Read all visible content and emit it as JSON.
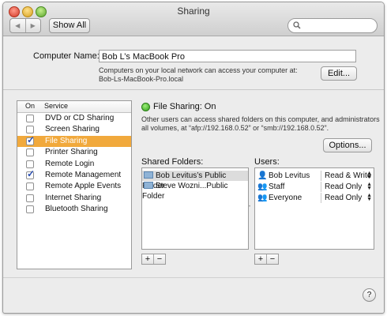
{
  "window": {
    "title": "Sharing"
  },
  "toolbar": {
    "back": "◀",
    "forward": "▶",
    "show_all": "Show All",
    "search_placeholder": ""
  },
  "computer_name": {
    "label": "Computer Name:",
    "value": "Bob L’s MacBook Pro",
    "info_line1": "Computers on your local network can access your computer at:",
    "info_line2": "Bob-Ls-MacBook-Pro.local",
    "edit_button": "Edit..."
  },
  "services": {
    "col_on": "On",
    "col_service": "Service",
    "items": [
      {
        "name": "DVD or CD Sharing",
        "on": false,
        "selected": false
      },
      {
        "name": "Screen Sharing",
        "on": false,
        "selected": false
      },
      {
        "name": "File Sharing",
        "on": true,
        "selected": true
      },
      {
        "name": "Printer Sharing",
        "on": false,
        "selected": false
      },
      {
        "name": "Remote Login",
        "on": false,
        "selected": false
      },
      {
        "name": "Remote Management",
        "on": true,
        "selected": false
      },
      {
        "name": "Remote Apple Events",
        "on": false,
        "selected": false
      },
      {
        "name": "Internet Sharing",
        "on": false,
        "selected": false
      },
      {
        "name": "Bluetooth Sharing",
        "on": false,
        "selected": false
      }
    ]
  },
  "detail": {
    "status": "File Sharing: On",
    "status_color": "#2f9e1b",
    "description_line1": "Other users can access shared folders on this computer, and administrators",
    "description_line2": "all volumes, at “afp://192.168.0.52” or “smb://192.168.0.52”.",
    "options_button": "Options..."
  },
  "shared_folders": {
    "label": "Shared Folders:",
    "items": [
      "Bob Levitus’s Public Folder",
      "Steve Wozni...Public Folder"
    ],
    "add": "+",
    "remove": "−"
  },
  "users": {
    "label": "Users:",
    "items": [
      {
        "name": "Bob Levitus",
        "permission": "Read & Write",
        "icon": "person-icon"
      },
      {
        "name": "Staff",
        "permission": "Read Only",
        "icon": "group-icon"
      },
      {
        "name": "Everyone",
        "permission": "Read Only",
        "icon": "group-icon"
      }
    ],
    "add": "+",
    "remove": "−"
  },
  "help": "?",
  "selection_color": "#f1a93c"
}
